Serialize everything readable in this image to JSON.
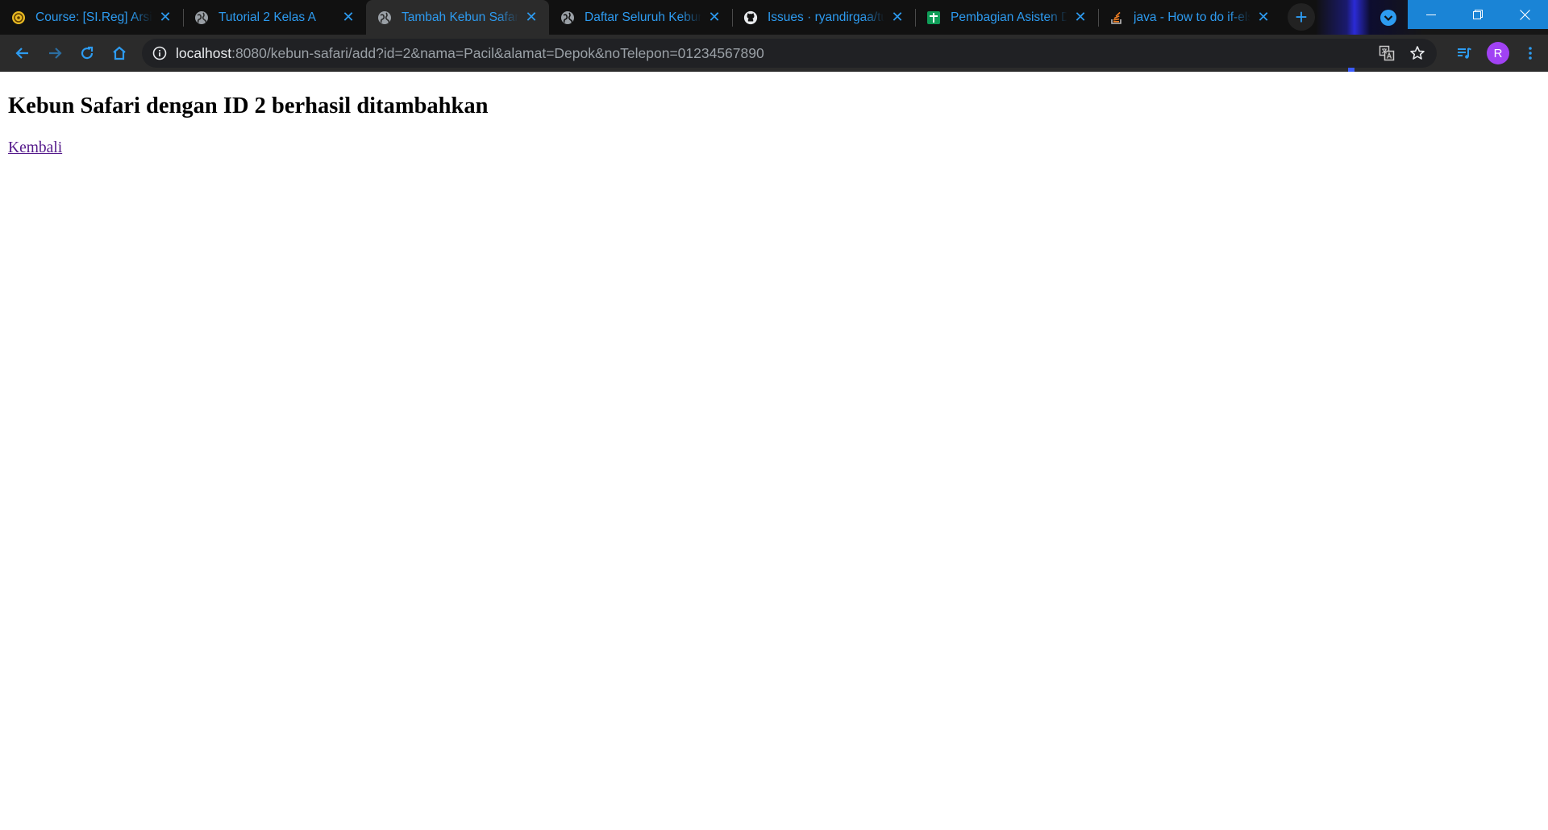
{
  "browser": {
    "tabs": [
      {
        "title": "Course: [SI.Reg] Arsitektur",
        "icon": "university-icon",
        "active": false
      },
      {
        "title": "Tutorial 2 Kelas A",
        "icon": "globe-icon",
        "active": false
      },
      {
        "title": "Tambah Kebun Safari",
        "icon": "globe-icon",
        "active": true
      },
      {
        "title": "Daftar Seluruh Kebun Safari",
        "icon": "globe-icon",
        "active": false
      },
      {
        "title": "Issues · ryandirgaa/tutorial",
        "icon": "github-icon",
        "active": false
      },
      {
        "title": "Pembagian Asisten Dosen",
        "icon": "sheets-icon",
        "active": false
      },
      {
        "title": "java - How to do if-else",
        "icon": "stackoverflow-icon",
        "active": false
      }
    ],
    "url_host": "localhost",
    "url_rest": ":8080/kebun-safari/add?id=2&nama=Pacil&alamat=Depok&noTelepon=01234567890",
    "profile_initial": "R",
    "accent_color": "#2d9bf0",
    "profile_color": "#a142f4"
  },
  "page": {
    "heading": "Kebun Safari dengan ID 2 berhasil ditambahkan",
    "back_link": "Kembali"
  }
}
